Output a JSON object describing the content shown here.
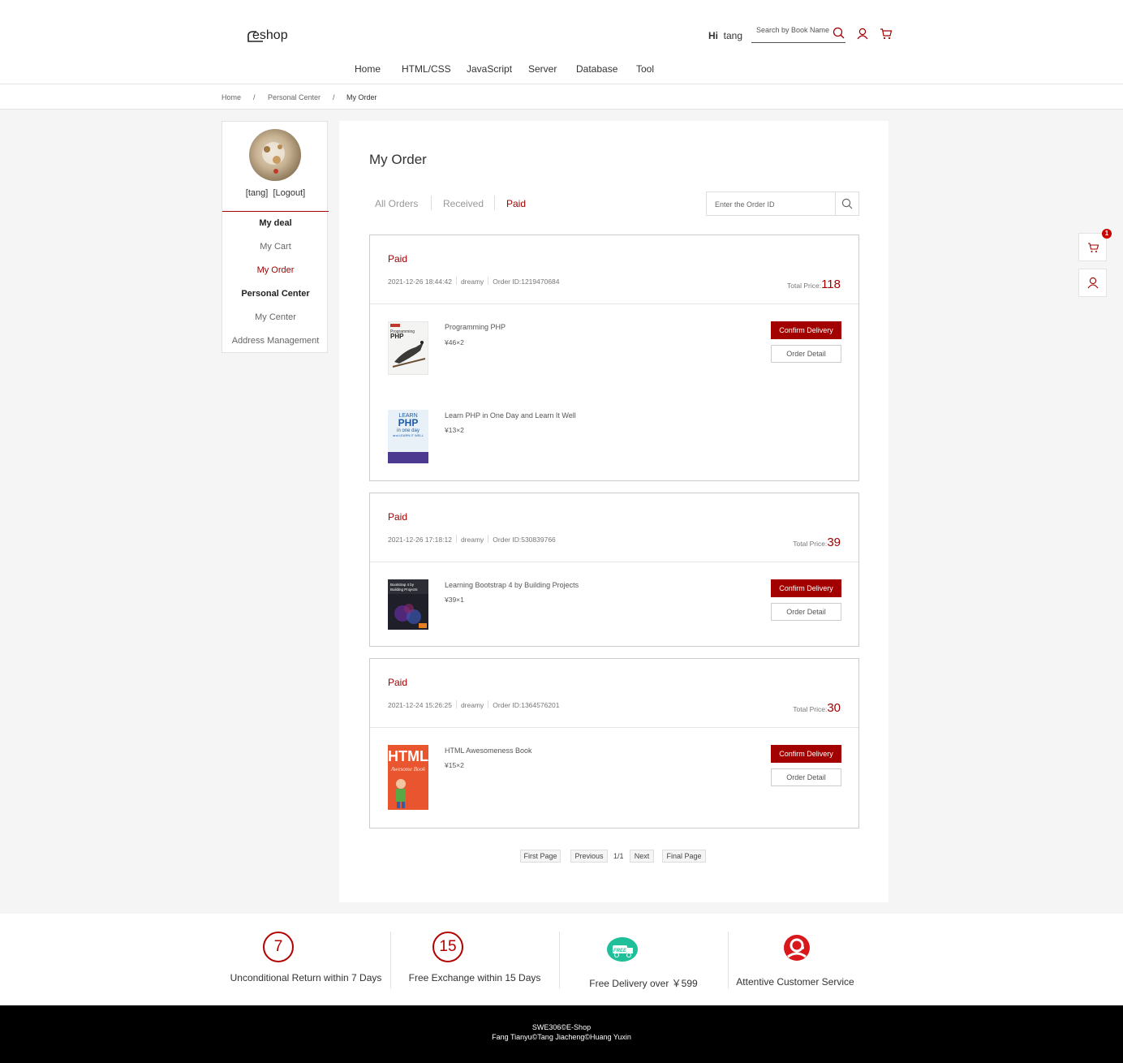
{
  "header": {
    "logo_text": "eshop",
    "greeting_prefix": "Hi",
    "username": "tang",
    "search_placeholder": "Search by Book Name",
    "nav": [
      "Home",
      "HTML/CSS",
      "JavaScript",
      "Server",
      "Database",
      "Tool"
    ]
  },
  "breadcrumb": {
    "items": [
      "Home",
      "Personal Center",
      "My Order"
    ],
    "separator": "/"
  },
  "sidebar": {
    "user_text": "[tang]",
    "logout_text": "[Logout]",
    "groups": [
      {
        "heading": "My deal",
        "items": [
          "My Cart",
          "My Order"
        ]
      },
      {
        "heading": "Personal Center",
        "items": [
          "My Center",
          "Address Management"
        ]
      }
    ],
    "active_item": "My Order"
  },
  "main": {
    "title": "My Order",
    "tabs": [
      "All Orders",
      "Received",
      "Paid"
    ],
    "active_tab": "Paid",
    "order_search_placeholder": "Enter the Order ID"
  },
  "orders": [
    {
      "status": "Paid",
      "datetime": "2021-12-26 18:44:42",
      "user": "dreamy",
      "order_id": "Order ID:1219470684",
      "total_label": "Total Price:",
      "total": "118",
      "items": [
        {
          "title": "Programming PHP",
          "price": "¥46×2"
        },
        {
          "title": "Learn PHP in One Day and Learn It Well",
          "price": "¥13×2"
        }
      ]
    },
    {
      "status": "Paid",
      "datetime": "2021-12-26 17:18:12",
      "user": "dreamy",
      "order_id": "Order ID:530839766",
      "total_label": "Total Price:",
      "total": "39",
      "items": [
        {
          "title": "Learning Bootstrap 4 by Building Projects",
          "price": "¥39×1"
        }
      ]
    },
    {
      "status": "Paid",
      "datetime": "2021-12-24 15:26:25",
      "user": "dreamy",
      "order_id": "Order ID:1364576201",
      "total_label": "Total Price:",
      "total": "30",
      "items": [
        {
          "title": "HTML Awesomeness Book",
          "price": "¥15×2"
        }
      ]
    }
  ],
  "buttons": {
    "confirm": "Confirm Delivery",
    "detail": "Order Detail"
  },
  "pager": {
    "first": "First Page",
    "previous": "Previous",
    "current": "1/1",
    "next": "Next",
    "last": "Final Page"
  },
  "float_bar": {
    "cart_count": "1"
  },
  "services": [
    {
      "icon_text": "7",
      "label": "Unconditional Return within 7 Days"
    },
    {
      "icon_text": "15",
      "label": "Free Exchange within 15 Days"
    },
    {
      "icon_text": "FREE",
      "label": "Free Delivery over ￥599"
    },
    {
      "icon_text": "",
      "label": "Attentive Customer Service"
    }
  ],
  "footer": {
    "line1": "SWE306©E-Shop",
    "line2": "Fang Tianyu©Tang Jiacheng©Huang Yuxin"
  },
  "colors": {
    "accent": "#a30000",
    "footer_bg": "#000000",
    "page_bg": "#f5f5f5"
  },
  "icons": [
    "search-icon",
    "user-icon",
    "cart-icon"
  ]
}
